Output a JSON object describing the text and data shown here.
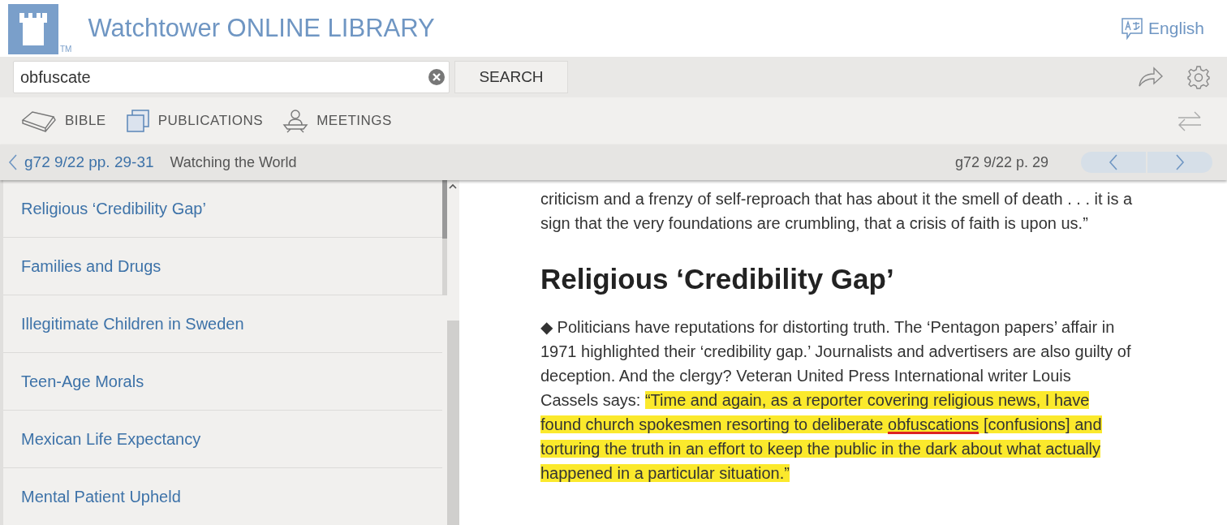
{
  "header": {
    "title": "Watchtower ONLINE LIBRARY",
    "trademark": "TM",
    "language": "English"
  },
  "search": {
    "value": "obfuscate",
    "button": "SEARCH"
  },
  "nav": [
    "BIBLE",
    "PUBLICATIONS",
    "MEETINGS"
  ],
  "breadcrumb": {
    "reference": "g72 9/22 pp. 29-31",
    "title": "Watching the World",
    "page": "g72 9/22 p. 29"
  },
  "sidebar": {
    "items": [
      "Religious ‘Credibility Gap’",
      "Families and Drugs",
      "Illegitimate Children in Sweden",
      "Teen-Age Morals",
      "Mexican Life Expectancy",
      "Mental Patient Upheld"
    ]
  },
  "article": {
    "intro": "criticism and a frenzy of self-reproach that has about it the smell of death . . . it is a sign that the very foundations are crumbling, that a crisis of faith is upon us.”",
    "heading": "Religious ‘Credibility Gap’",
    "paragraph": [
      {
        "text": "◆ Politicians have reputations for distorting truth. The ‘Pentagon papers’ affair in 1971 highlighted their ‘credibility gap.’ Journalists and advertisers are also guilty of deception. And the clergy? Veteran United Press International writer Louis Cassels says: ",
        "highlighted": false,
        "underlined": false
      },
      {
        "text": "“Time and again, as a reporter covering religious news, I have found church spokesmen resorting to deliberate ",
        "highlighted": true,
        "underlined": false
      },
      {
        "text": "obfuscations",
        "highlighted": true,
        "underlined": true
      },
      {
        "text": " [confusions] and torturing the truth in an effort to keep the public in the dark about what actually happened in a particular situation.”",
        "highlighted": true,
        "underlined": false
      }
    ]
  }
}
